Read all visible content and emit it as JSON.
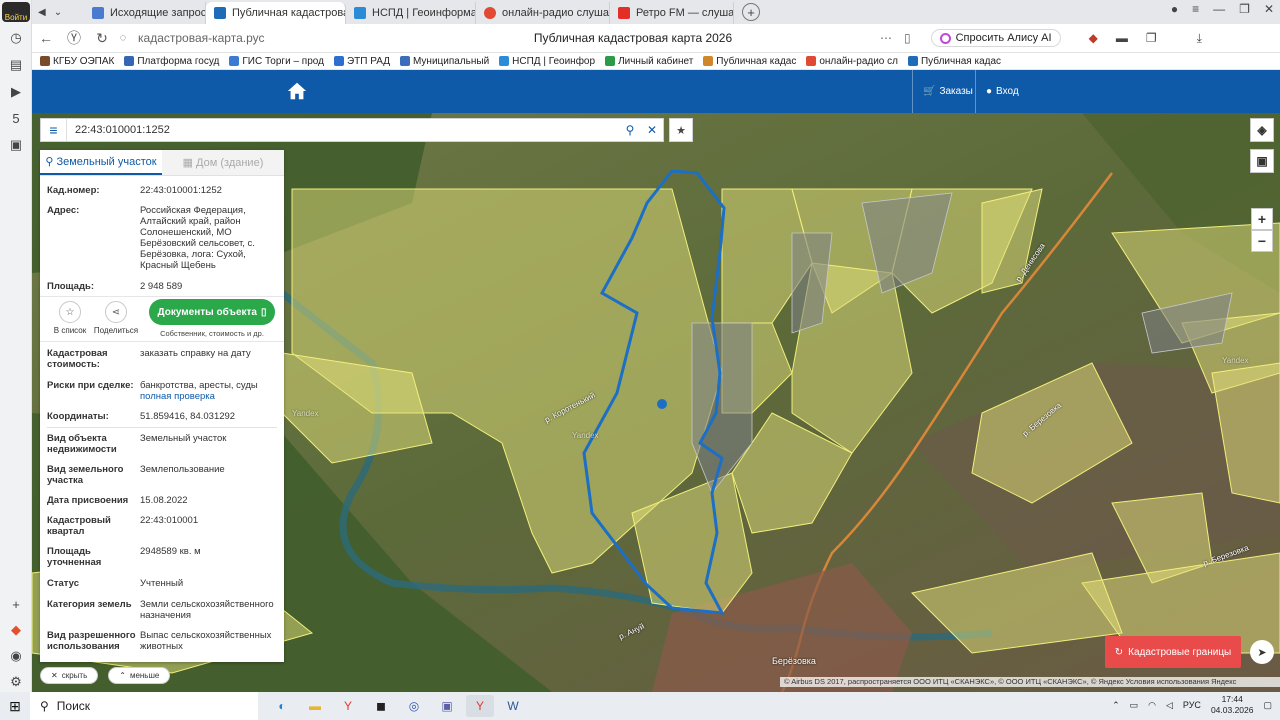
{
  "browser": {
    "login_badge": "Войти",
    "tabs": [
      {
        "label": "Исходящие запросы СМЭ",
        "icon": "doc-icon",
        "color": "#4a7bd1",
        "active": false
      },
      {
        "label": "Публичная кадастровая",
        "icon": "cadastre-icon",
        "color": "#1e6bb8",
        "active": true
      },
      {
        "label": "НСПД | Геоинформацион",
        "icon": "nspd-icon",
        "color": "#2b8bd6",
        "active": false
      },
      {
        "label": "онлайн-радио слушать бе",
        "icon": "yandex-icon",
        "color": "#e04a33",
        "active": false
      },
      {
        "label": "Ретро FM — слушать",
        "icon": "youtube-icon",
        "color": "#e52d27",
        "active": false
      }
    ],
    "url": "кадастровая-карта.рус",
    "page_title": "Публичная кадастровая карта 2026",
    "alice_label": "Спросить Алису AI",
    "bookmarks": [
      {
        "label": "КГБУ ОЭПАК",
        "color": "#7a4b2a"
      },
      {
        "label": "Платформа госуд",
        "color": "#3566b5"
      },
      {
        "label": "ГИС Торги – прод",
        "color": "#3d7bd2"
      },
      {
        "label": "ЭТП РАД",
        "color": "#2d6fcf"
      },
      {
        "label": "Муниципальный",
        "color": "#3b6dbb"
      },
      {
        "label": "НСПД | Геоинфор",
        "color": "#2b8bd6"
      },
      {
        "label": "Личный кабинет",
        "color": "#2c9a4b"
      },
      {
        "label": "Публичная кадас",
        "color": "#d1862b"
      },
      {
        "label": "онлайн-радио сл",
        "color": "#e04a33"
      },
      {
        "label": "Публичная кадас",
        "color": "#1e6bb8"
      }
    ]
  },
  "header": {
    "orders_label": "Заказы",
    "login_label": "Вход"
  },
  "search": {
    "value": "22:43:010001:1252"
  },
  "panel": {
    "tab_land": "Земельный участок",
    "tab_house": "Дом (здание)",
    "cad_number_key": "Кад.номер:",
    "cad_number": "22:43:010001:1252",
    "address_key": "Адрес:",
    "address": "Российская Федерация, Алтайский край, район Солонешенский, МО Берёзовский сельсовет, с. Берёзовка, лога: Сухой, Красный Щебень",
    "area_key": "Площадь:",
    "area": "2 948 589",
    "action_list": "В список",
    "action_share": "Поделиться",
    "docs_button": "Документы объекта",
    "docs_sub": "Собственник, стоимость и др.",
    "cad_cost_key": "Кадастровая стоимость:",
    "cad_cost_link": "заказать справку на дату",
    "risks_key": "Риски при сделке:",
    "risks_value": "банкротства, аресты, суды",
    "risks_link": "полная проверка",
    "coords_key": "Координаты:",
    "coords": "51.859416, 84.031292",
    "type_key": "Вид объекта недвижимости",
    "type_value": "Земельный участок",
    "land_type_key": "Вид земельного участка",
    "land_type_value": "Землепользование",
    "assign_date_key": "Дата присвоения",
    "assign_date_value": "15.08.2022",
    "quarter_key": "Кадастровый квартал",
    "quarter_value": "22:43:010001",
    "area_precise_key": "Площадь уточненная",
    "area_precise_value": "2948589 кв. м",
    "status_key": "Статус",
    "status_value": "Учтенный",
    "category_key": "Категория земель",
    "category_value": "Земли сельскохозяйственного назначения",
    "use_key": "Вид разрешенного использования",
    "use_value": "Выпас сельскохозяйственных животных",
    "hide_label": "скрыть",
    "less_label": "меньше"
  },
  "map": {
    "labels": {
      "river_korotenky": "р. Коротенький",
      "river_anui": "р. Ануй",
      "river_berezovka": "р. Березовка",
      "river_denisovka": "р. Денисова",
      "river_berezovka2": "р. Березовка",
      "village": "Берёзовка",
      "yandex1": "Yandex",
      "yandex2": "Yandex",
      "yandex3": "Yandex"
    },
    "cad_button": "Кадастровые границы",
    "attribution": "© Airbus DS 2017, распространяется ООО ИТЦ «СКАНЭКС», © ООО ИТЦ «СКАНЭКС», © Яндекс Условия использования  Яндекс",
    "zoom_in": "+",
    "zoom_out": "−"
  },
  "taskbar": {
    "search_label": "Поиск",
    "lang": "РУС",
    "time": "17:44",
    "date": "04.03.2026"
  },
  "colors": {
    "header_blue": "#0f5aa8",
    "docs_green": "#2aa84a",
    "cad_red": "#e94b4b",
    "parcel_outline": "#1c6fc4"
  }
}
